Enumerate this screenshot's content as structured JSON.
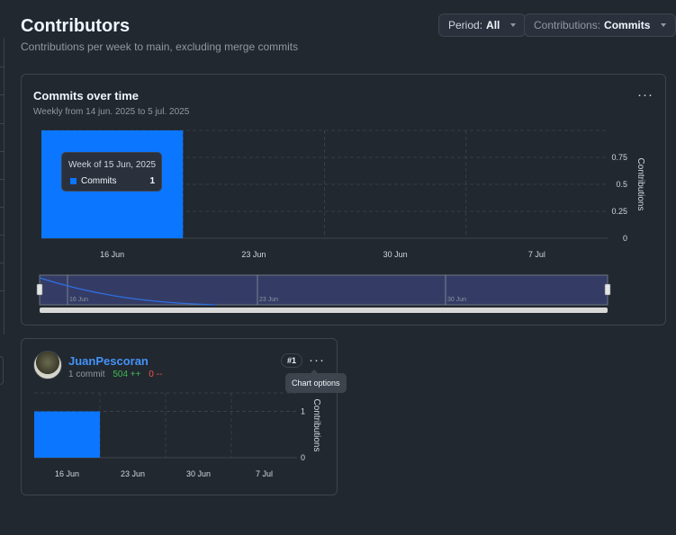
{
  "header": {
    "title": "Contributors",
    "subtitle": "Contributions per week to main, excluding merge commits"
  },
  "controls": {
    "period_label": "Period:",
    "period_value": "All",
    "contributions_label": "Contributions:",
    "contributions_value": "Commits"
  },
  "main_chart": {
    "title": "Commits over time",
    "subtitle": "Weekly from 14 jun. 2025 to 5 jul. 2025",
    "y_axis_label": "Contributions",
    "tooltip": {
      "title": "Week of 15 Jun, 2025",
      "series": "Commits",
      "value": "1"
    },
    "navigator_labels": [
      "16 Jun",
      "23 Jun",
      "30 Jun"
    ]
  },
  "contributor": {
    "name": "JuanPescoran",
    "commits": "1 commit",
    "additions": "504 ++",
    "deletions": "0 --",
    "rank": "#1",
    "y_axis_label": "Contributions",
    "tooltip": "Chart options"
  },
  "colors": {
    "bar": "#0b76ff",
    "background": "#212830",
    "border": "#3d444d",
    "link": "#4493f8"
  },
  "chart_data": [
    {
      "type": "bar",
      "x": [
        "16 Jun",
        "23 Jun",
        "30 Jun",
        "7 Jul"
      ],
      "values": [
        1,
        0,
        0,
        0
      ],
      "series": [
        {
          "name": "Commits",
          "values": [
            1,
            0,
            0,
            0
          ]
        }
      ],
      "y_ticks": [
        "0",
        "0.25",
        "0.5",
        "0.75"
      ],
      "ylim": [
        0,
        1
      ],
      "ylabel": "Contributions",
      "grid": true
    },
    {
      "type": "bar",
      "x": [
        "16 Jun",
        "23 Jun",
        "30 Jun",
        "7 Jul"
      ],
      "values": [
        1,
        0,
        0,
        0
      ],
      "y_ticks": [
        "0",
        "1"
      ],
      "ylim": [
        0,
        1.4
      ],
      "ylabel": "Contributions",
      "grid": true
    }
  ]
}
